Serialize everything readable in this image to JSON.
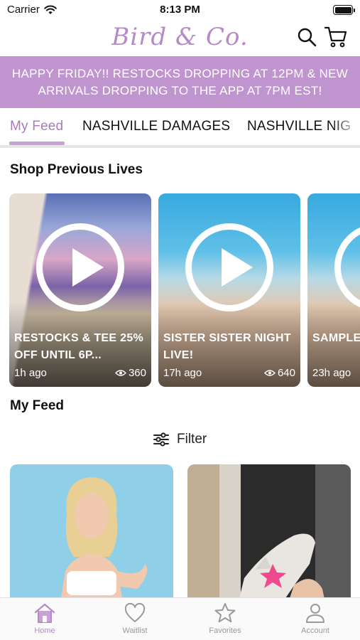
{
  "status_bar": {
    "carrier": "Carrier",
    "time": "8:13 PM"
  },
  "header": {
    "logo": "Bird & Co."
  },
  "banner": {
    "text": "HAPPY FRIDAY!! RESTOCKS DROPPING AT 12PM & NEW ARRIVALS DROPPING TO THE APP AT 7PM EST!"
  },
  "tabs": [
    "My Feed",
    "NASHVILLE DAMAGES",
    "NASHVILLE NIG"
  ],
  "lives": {
    "title": "Shop Previous Lives",
    "items": [
      {
        "title": "RESTOCKS & TEE 25% OFF UNTIL 6P...",
        "time": "1h ago",
        "views": "360"
      },
      {
        "title": "SISTER SISTER NIGHT LIVE!",
        "time": "17h ago",
        "views": "640"
      },
      {
        "title": "SAMPLE SALE!!",
        "time": "23h ago",
        "views": ""
      }
    ]
  },
  "feed": {
    "title": "My Feed",
    "filter_label": "Filter"
  },
  "bottom_nav": [
    {
      "label": "Home",
      "icon": "home-icon",
      "active": true
    },
    {
      "label": "Waitlist",
      "icon": "heart-icon",
      "active": false
    },
    {
      "label": "Favorites",
      "icon": "star-icon",
      "active": false
    },
    {
      "label": "Account",
      "icon": "person-icon",
      "active": false
    }
  ],
  "colors": {
    "accent": "#b48ac7",
    "banner": "#bf94cf"
  }
}
